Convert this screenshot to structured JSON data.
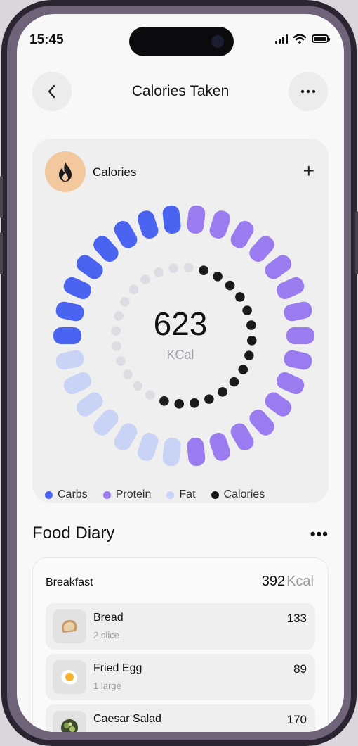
{
  "status_bar": {
    "time": "15:45"
  },
  "header": {
    "title": "Calories Taken",
    "back_icon": "chevron-left-icon",
    "more_icon": "more-horizontal-icon"
  },
  "calories_card": {
    "label": "Calories",
    "icon": "flame-icon",
    "add_icon": "plus-icon",
    "value": "623",
    "unit": "KCal",
    "colors": {
      "carbs": "#4a63f0",
      "protein": "#9b7bf0",
      "fat": "#c9d3f6",
      "calories": "#1a1a1a",
      "track": "#dcdde3"
    },
    "legend": [
      "Carbs",
      "Protein",
      "Fat",
      "Calories"
    ]
  },
  "food_diary": {
    "title": "Food Diary",
    "more": "•••",
    "meals": [
      {
        "name": "Breakfast",
        "total": "392",
        "unit": "Kcal",
        "items": [
          {
            "name": "Bread",
            "qty": "2 slice",
            "cal": "133",
            "icon": "bread-icon"
          },
          {
            "name": "Fried Egg",
            "qty": "1 large",
            "cal": "89",
            "icon": "fried-egg-icon"
          },
          {
            "name": "Caesar Salad",
            "qty": "",
            "cal": "170",
            "icon": "salad-icon"
          }
        ]
      }
    ]
  }
}
